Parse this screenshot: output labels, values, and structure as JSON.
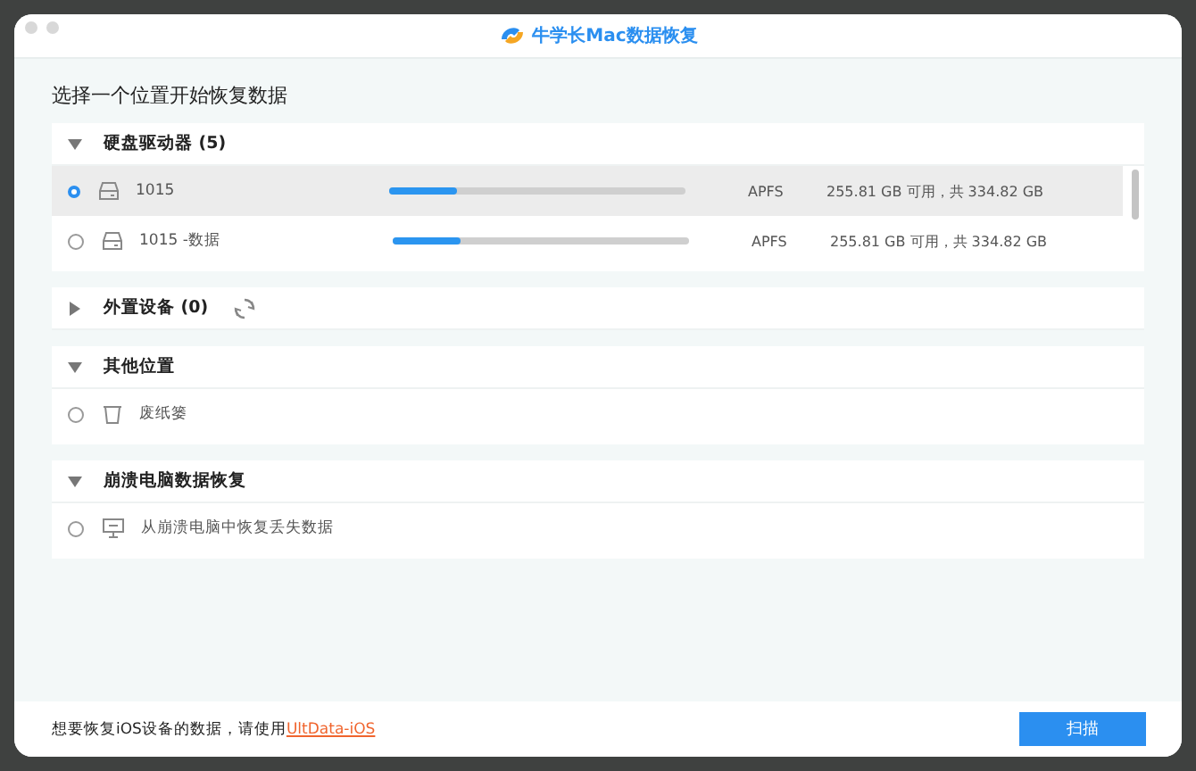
{
  "window": {
    "title": "牛学长Mac数据恢复"
  },
  "heading": "选择一个位置开始恢复数据",
  "sections": [
    {
      "title": "硬盘驱动器 (5)",
      "expanded": true,
      "loading": false,
      "items": [
        {
          "kind": "drive",
          "name": "1015",
          "selected": true,
          "level": 0.23,
          "filesystem": "APFS",
          "capacity": "255.81 GB 可用，共 334.82 GB"
        },
        {
          "kind": "drive",
          "name": "1015 -数据",
          "selected": false,
          "level": 0.23,
          "filesystem": "APFS",
          "capacity": "255.81 GB 可用，共 334.82 GB"
        }
      ]
    },
    {
      "title": "外置设备 (0)",
      "expanded": false,
      "loading": true
    },
    {
      "title": "其他位置",
      "expanded": true,
      "loading": false,
      "items": [
        {
          "kind": "trash",
          "name": "废纸篓",
          "selected": false
        }
      ]
    },
    {
      "title": "崩溃电脑数据恢复",
      "expanded": true,
      "loading": false,
      "items": [
        {
          "kind": "monitor",
          "name": "从崩溃电脑中恢复丢失数据",
          "selected": false
        }
      ]
    }
  ],
  "footer": {
    "text": "想要恢复iOS设备的数据，请使用",
    "link": "UltData-iOS",
    "button": "扫描"
  }
}
